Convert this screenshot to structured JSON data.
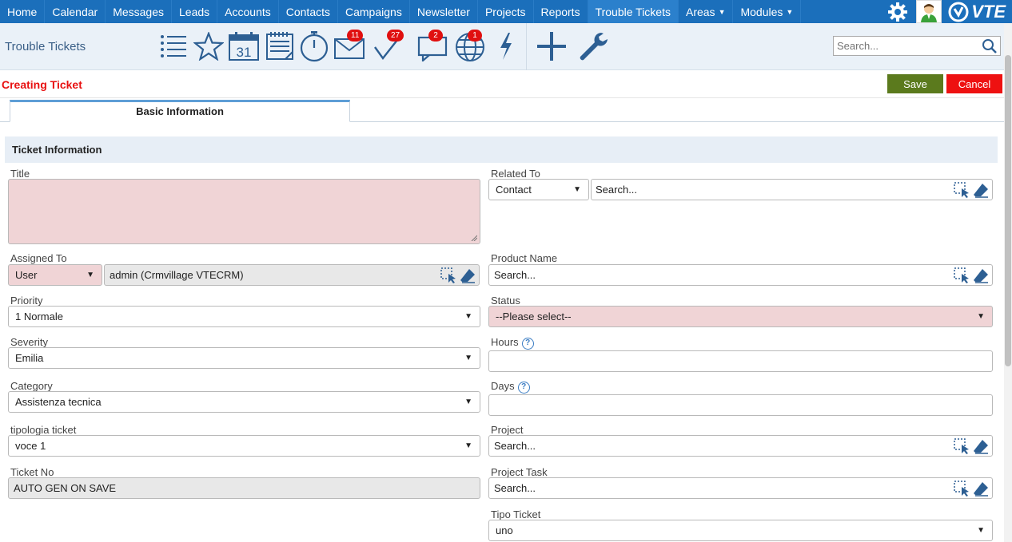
{
  "nav": {
    "items": [
      "Home",
      "Calendar",
      "Messages",
      "Leads",
      "Accounts",
      "Contacts",
      "Campaigns",
      "Newsletter",
      "Projects",
      "Reports",
      "Trouble Tickets",
      "Areas",
      "Modules"
    ],
    "active": "Trouble Tickets",
    "logo_text": "VTE"
  },
  "toolbar": {
    "module_title": "Trouble Tickets",
    "calendar_day": "31",
    "badges": {
      "messages": "11",
      "todos": "27",
      "chat": "2",
      "notifications": "1"
    },
    "search_placeholder": "Search..."
  },
  "actions": {
    "heading": "Creating Ticket",
    "save_label": "Save",
    "cancel_label": "Cancel"
  },
  "tabs": {
    "basic": "Basic Information"
  },
  "section": {
    "title": "Ticket Information"
  },
  "form": {
    "title_label": "Title",
    "assigned_label": "Assigned To",
    "assigned_type": "User",
    "assigned_value": "admin (Crmvillage VTECRM)",
    "priority_label": "Priority",
    "priority_value": "1 Normale",
    "severity_label": "Severity",
    "severity_value": "Emilia",
    "category_label": "Category",
    "category_value": "Assistenza tecnica",
    "tipologia_label": "tipologia ticket",
    "tipologia_value": "voce 1",
    "ticketno_label": "Ticket No",
    "ticketno_value": "AUTO GEN ON SAVE",
    "related_label": "Related To",
    "related_type": "Contact",
    "related_value": "Search...",
    "product_label": "Product Name",
    "product_value": "Search...",
    "status_label": "Status",
    "status_value": "--Please select--",
    "hours_label": "Hours",
    "days_label": "Days",
    "project_label": "Project",
    "project_value": "Search...",
    "projecttask_label": "Project Task",
    "projecttask_value": "Search...",
    "tipo_label": "Tipo Ticket",
    "tipo_value": "uno"
  },
  "colors": {
    "nav_bg": "#1b6fbb",
    "heading_red": "#e81010",
    "save_green": "#5b7a1d",
    "cancel_red": "#ee1111",
    "required_pink": "#f0d4d6",
    "icon_blue": "#2d5f93"
  }
}
